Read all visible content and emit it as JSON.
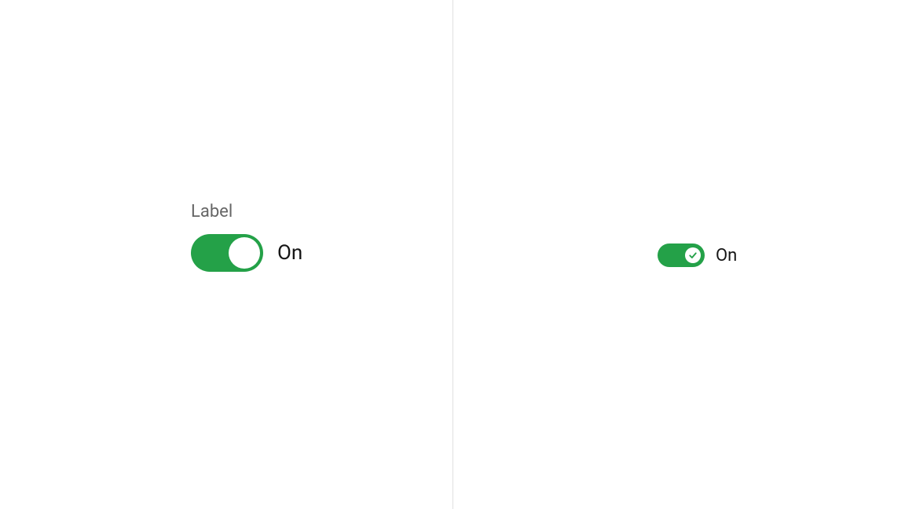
{
  "left": {
    "label": "Label",
    "status": "On",
    "checked": true
  },
  "right": {
    "status": "On",
    "checked": true
  },
  "colors": {
    "accent": "#24a148"
  }
}
